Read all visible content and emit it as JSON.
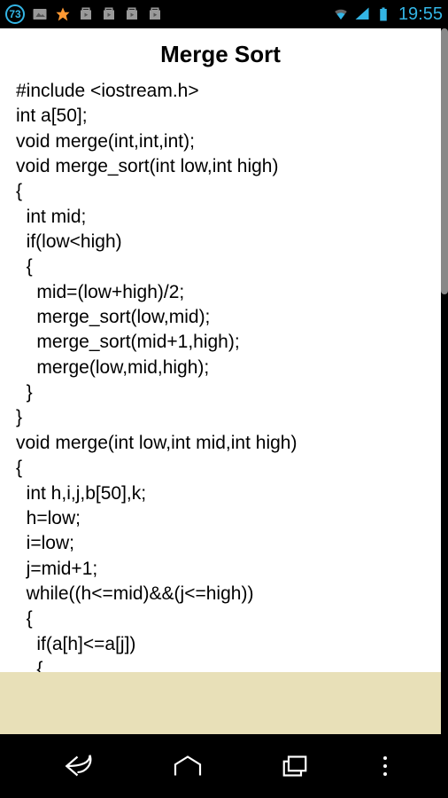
{
  "status": {
    "badge": "73",
    "time": "19:55"
  },
  "page": {
    "title": "Merge Sort",
    "code": "#include <iostream.h>\nint a[50];\nvoid merge(int,int,int);\nvoid merge_sort(int low,int high)\n{\n  int mid;\n  if(low<high)\n  {\n    mid=(low+high)/2;\n    merge_sort(low,mid);\n    merge_sort(mid+1,high);\n    merge(low,mid,high);\n  }\n}\nvoid merge(int low,int mid,int high)\n{\n  int h,i,j,b[50],k;\n  h=low;\n  i=low;\n  j=mid+1;\n  while((h<=mid)&&(j<=high))\n  {\n    if(a[h]<=a[j])\n    {\n      b[i]=a[h];"
  }
}
